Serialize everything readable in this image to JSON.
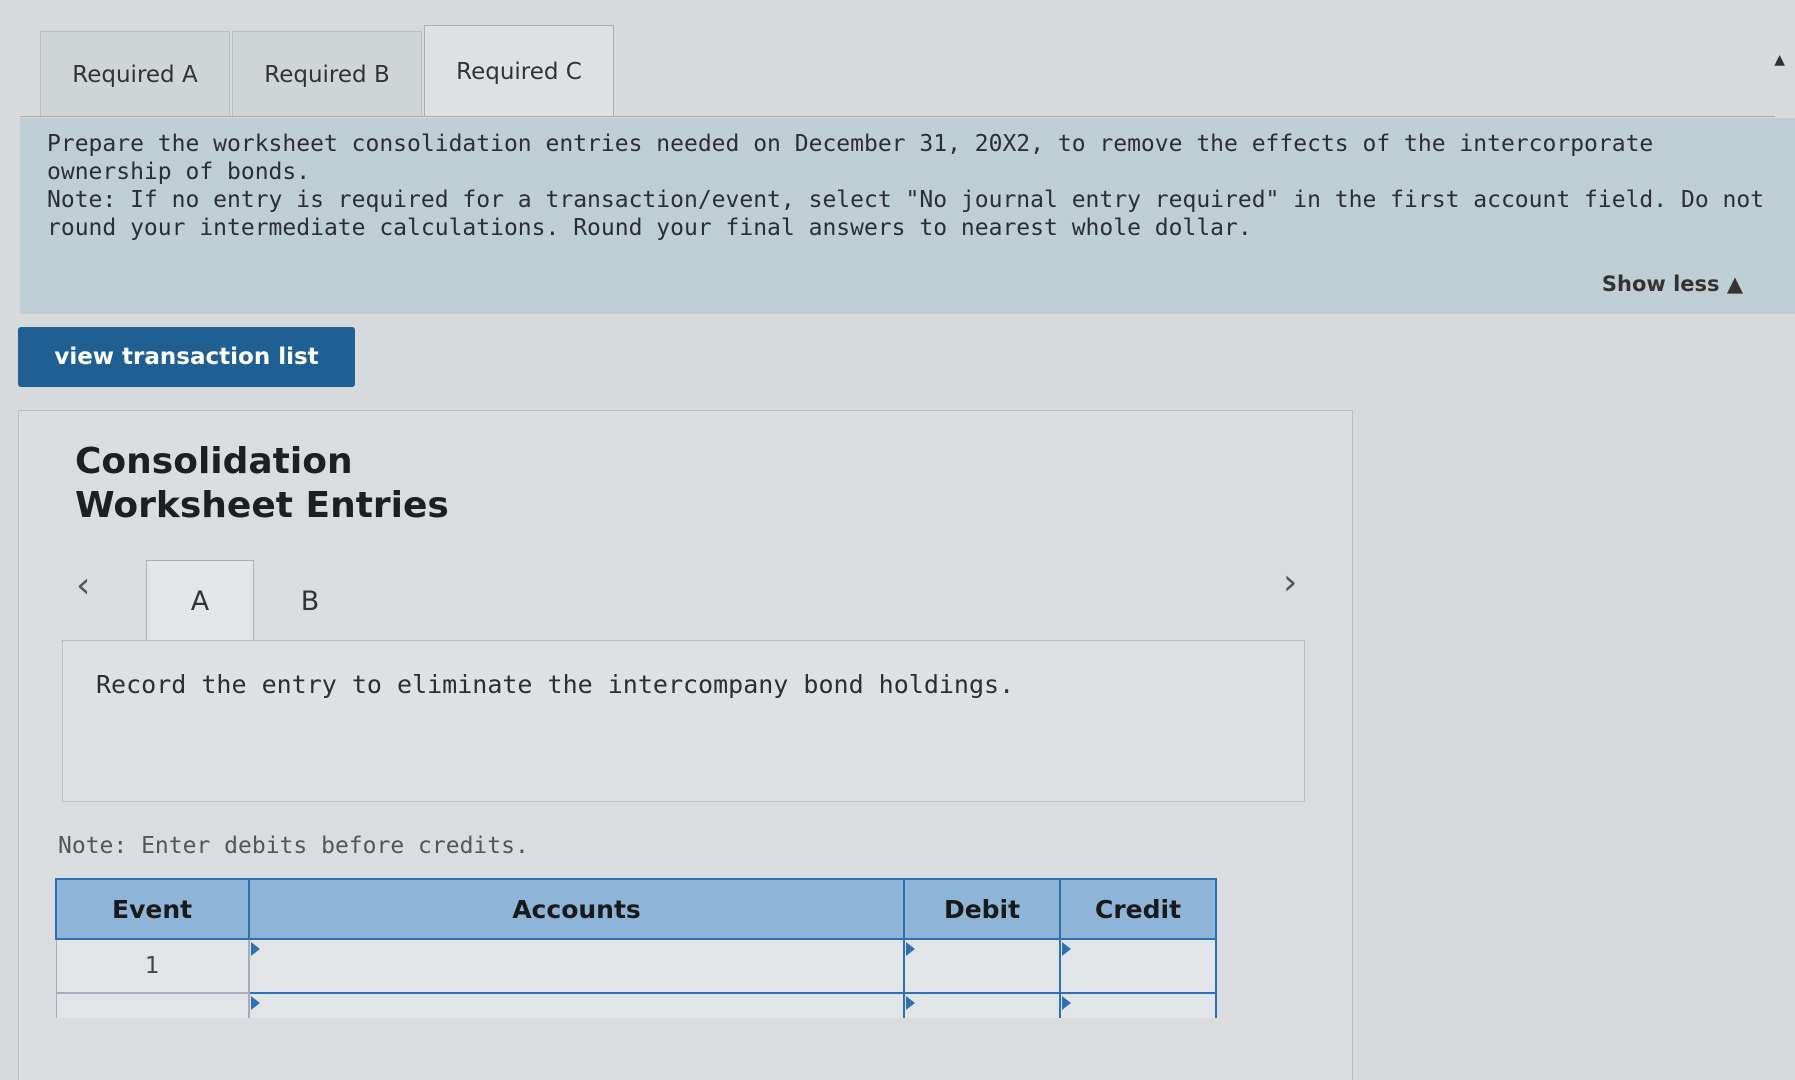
{
  "top_tabs": [
    {
      "label": "Required A",
      "active": false
    },
    {
      "label": "Required B",
      "active": false
    },
    {
      "label": "Required C",
      "active": true
    }
  ],
  "instructions": {
    "text": "Prepare the worksheet consolidation entries needed on December 31, 20X2, to remove the effects of the intercorporate ownership of bonds.",
    "note": "Note: If no entry is required for a transaction/event, select \"No journal entry required\" in the first account field. Do not round your intermediate calculations. Round your final answers to nearest whole dollar.",
    "show_less": "Show less ▲"
  },
  "view_button": "view transaction list",
  "panel": {
    "title_line1": "Consolidation",
    "title_line2": "Worksheet Entries",
    "sub_tabs": [
      {
        "label": "A",
        "active": true
      },
      {
        "label": "B",
        "active": false
      }
    ],
    "prev_icon": "‹",
    "next_icon": "›",
    "entry_instruction": "Record the entry to eliminate the intercompany bond holdings.",
    "note": "Note: Enter debits before credits."
  },
  "table": {
    "headers": [
      "Event",
      "Accounts",
      "Debit",
      "Credit"
    ],
    "rows": [
      {
        "event": "1",
        "account": "",
        "debit": "",
        "credit": ""
      }
    ]
  },
  "scroll_up_icon": "▲"
}
